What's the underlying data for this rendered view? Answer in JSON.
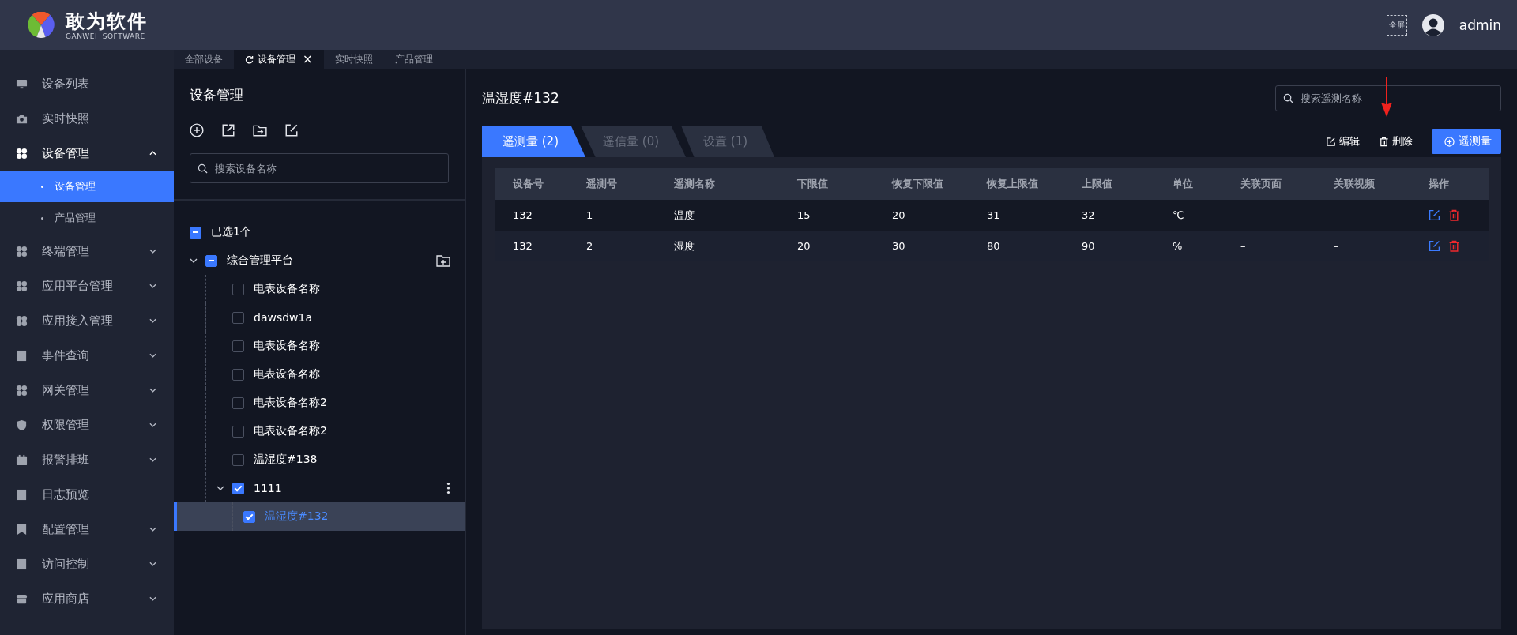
{
  "header": {
    "brand": "敢为软件",
    "brand_sub": "GANWEI  SOFTWARE",
    "fullscreen": "全屏",
    "user": "admin"
  },
  "page_tabs": [
    {
      "label": "全部设备",
      "selected": false
    },
    {
      "label": "设备管理",
      "selected": true,
      "close": "×"
    },
    {
      "label": "实时快照",
      "selected": false
    },
    {
      "label": "产品管理",
      "selected": false
    }
  ],
  "sidebar": {
    "items": [
      {
        "label": "设备列表"
      },
      {
        "label": "实时快照"
      },
      {
        "label": "设备管理",
        "expanded": true,
        "children": [
          {
            "label": "设备管理",
            "selected": true
          },
          {
            "label": "产品管理",
            "selected": false
          }
        ]
      },
      {
        "label": "终端管理",
        "expanded": false
      },
      {
        "label": "应用平台管理",
        "expanded": false
      },
      {
        "label": "应用接入管理",
        "expanded": false
      },
      {
        "label": "事件查询",
        "expanded": false
      },
      {
        "label": "网关管理",
        "expanded": false
      },
      {
        "label": "权限管理",
        "expanded": false
      },
      {
        "label": "报警排班",
        "expanded": false
      },
      {
        "label": "日志预览"
      },
      {
        "label": "配置管理",
        "expanded": false
      },
      {
        "label": "访问控制",
        "expanded": false
      },
      {
        "label": "应用商店",
        "expanded": false
      }
    ]
  },
  "tree_panel": {
    "title": "设备管理",
    "search": {
      "placeholder": "搜索设备名称"
    },
    "selection": {
      "label": "已选1个",
      "checked": false,
      "indeterminate": true
    },
    "tree": [
      {
        "label": "综合管理平台",
        "checked": false,
        "indeterminate": true,
        "expanded": true,
        "selected": false,
        "children": [
          {
            "label": "电表设备名称",
            "checked": false,
            "indeterminate": false,
            "selected": false
          },
          {
            "label": "dawsdw1a",
            "checked": false,
            "indeterminate": false,
            "selected": false
          },
          {
            "label": "电表设备名称",
            "checked": false,
            "indeterminate": false,
            "selected": false
          },
          {
            "label": "电表设备名称",
            "checked": false,
            "indeterminate": false,
            "selected": false
          },
          {
            "label": "电表设备名称2",
            "checked": false,
            "indeterminate": false,
            "selected": false
          },
          {
            "label": "电表设备名称2",
            "checked": false,
            "indeterminate": false,
            "selected": false
          },
          {
            "label": "温湿度#138",
            "checked": false,
            "indeterminate": false,
            "selected": false
          },
          {
            "label": "1111",
            "checked": true,
            "indeterminate": false,
            "expanded": true,
            "selected": false,
            "children": [
              {
                "label": "温湿度#132",
                "checked": true,
                "indeterminate": false,
                "selected": true
              }
            ]
          }
        ]
      }
    ]
  },
  "detail": {
    "title": "温湿度#132",
    "search": {
      "placeholder": "搜索遥测名称"
    },
    "tabs": [
      {
        "label": "遥测量 (2)",
        "selected": true
      },
      {
        "label": "遥信量 (0)",
        "selected": false
      },
      {
        "label": "设置 (1)",
        "selected": false
      }
    ],
    "actions": {
      "edit": "编辑",
      "delete": "删除",
      "add": "遥测量"
    },
    "table": {
      "columns": [
        "设备号",
        "遥测号",
        "遥测名称",
        "下限值",
        "恢复下限值",
        "恢复上限值",
        "上限值",
        "单位",
        "关联页面",
        "关联视频",
        "操作"
      ],
      "rows": [
        [
          "132",
          "1",
          "温度",
          "15",
          "20",
          "31",
          "32",
          "℃",
          "–",
          "–"
        ],
        [
          "132",
          "2",
          "湿度",
          "20",
          "30",
          "80",
          "90",
          "%",
          "–",
          "–"
        ]
      ]
    }
  },
  "annotation": {
    "arrow": true
  }
}
